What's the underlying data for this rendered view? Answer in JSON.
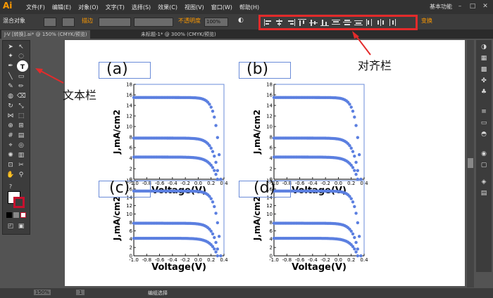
{
  "menubar": {
    "logo": "Ai",
    "items": [
      "文件(F)",
      "编辑(E)",
      "对象(O)",
      "文字(T)",
      "选择(S)",
      "效果(C)",
      "视图(V)",
      "窗口(W)",
      "帮助(H)"
    ],
    "workspace": "基本功能"
  },
  "controlbar": {
    "selection_label": "混合对象",
    "stroke_label": "描边",
    "opacity_label": "不透明度",
    "opacity_value": "100%",
    "transform_label": "变换"
  },
  "tabs": [
    {
      "label": "J-V [转换].ai* @ 150% (CMYK/预览)"
    },
    {
      "label": "未标题-1* @ 300% (CMYK/预览)"
    }
  ],
  "annotations": {
    "align_label": "对齐栏",
    "text_tool_label": "文本栏"
  },
  "panels": [
    {
      "label": "(a)"
    },
    {
      "label": "(b)"
    },
    {
      "label": "(c)"
    },
    {
      "label": "(d)"
    }
  ],
  "statusbar": {
    "zoom": "150%",
    "page": "1",
    "status_text": "编组选择"
  },
  "colors": {
    "accent": "#ff9a00",
    "highlight": "#e32b2b",
    "series": "#5b7fe0"
  },
  "chart_data": [
    {
      "type": "scatter",
      "xlabel": "Voltage(V)",
      "ylabel": "J,mA/cm2",
      "xlim": [
        -1.0,
        0.4
      ],
      "ylim": [
        0,
        18
      ],
      "xticks": [
        "-1.0",
        "-0.8",
        "-0.6",
        "-0.4",
        "-0.2",
        "0.0",
        "0.2",
        "0.4"
      ],
      "yticks": [
        "0",
        "2",
        "4",
        "6",
        "8",
        "10",
        "12",
        "14",
        "16",
        "18"
      ],
      "series": [
        {
          "jsc": 15.5,
          "voc": 0.35
        },
        {
          "jsc": 7.8,
          "voc": 0.32
        },
        {
          "jsc": 4.2,
          "voc": 0.3
        }
      ]
    },
    {
      "type": "scatter",
      "xlabel": "Voltage(V)",
      "ylabel": "J,mA/cm2",
      "xlim": [
        -1.0,
        0.4
      ],
      "ylim": [
        0,
        18
      ],
      "xticks": [
        "-1.0",
        "-0.8",
        "-0.6",
        "-0.4",
        "-0.2",
        "0.0",
        "0.2",
        "0.4"
      ],
      "yticks": [
        "0",
        "2",
        "4",
        "6",
        "8",
        "10",
        "12",
        "14",
        "16",
        "18"
      ],
      "series": [
        {
          "jsc": 15.5,
          "voc": 0.35
        },
        {
          "jsc": 7.8,
          "voc": 0.32
        },
        {
          "jsc": 4.2,
          "voc": 0.3
        }
      ]
    },
    {
      "type": "scatter",
      "xlabel": "Voltage(V)",
      "ylabel": "J,mA/cm2",
      "xlim": [
        -1.0,
        0.4
      ],
      "ylim": [
        0,
        18
      ],
      "xticks": [
        "-1.0",
        "-0.8",
        "-0.6",
        "-0.4",
        "-0.2",
        "0.0",
        "0.2",
        "0.4"
      ],
      "yticks": [
        "0",
        "2",
        "4",
        "6",
        "8",
        "10",
        "12",
        "14",
        "16",
        "18"
      ],
      "series": [
        {
          "jsc": 15.5,
          "voc": 0.35
        },
        {
          "jsc": 7.8,
          "voc": 0.32
        },
        {
          "jsc": 4.2,
          "voc": 0.3
        }
      ]
    },
    {
      "type": "scatter",
      "xlabel": "Voltage(V)",
      "ylabel": "J,mA/cm2",
      "xlim": [
        -1.0,
        0.4
      ],
      "ylim": [
        0,
        18
      ],
      "xticks": [
        "-1.0",
        "-0.8",
        "-0.6",
        "-0.4",
        "-0.2",
        "0.0",
        "0.2",
        "0.4"
      ],
      "yticks": [
        "0",
        "2",
        "4",
        "6",
        "8",
        "10",
        "12",
        "14",
        "16",
        "18"
      ],
      "series": [
        {
          "jsc": 15.5,
          "voc": 0.35
        },
        {
          "jsc": 7.8,
          "voc": 0.32
        },
        {
          "jsc": 4.2,
          "voc": 0.3
        }
      ]
    }
  ]
}
